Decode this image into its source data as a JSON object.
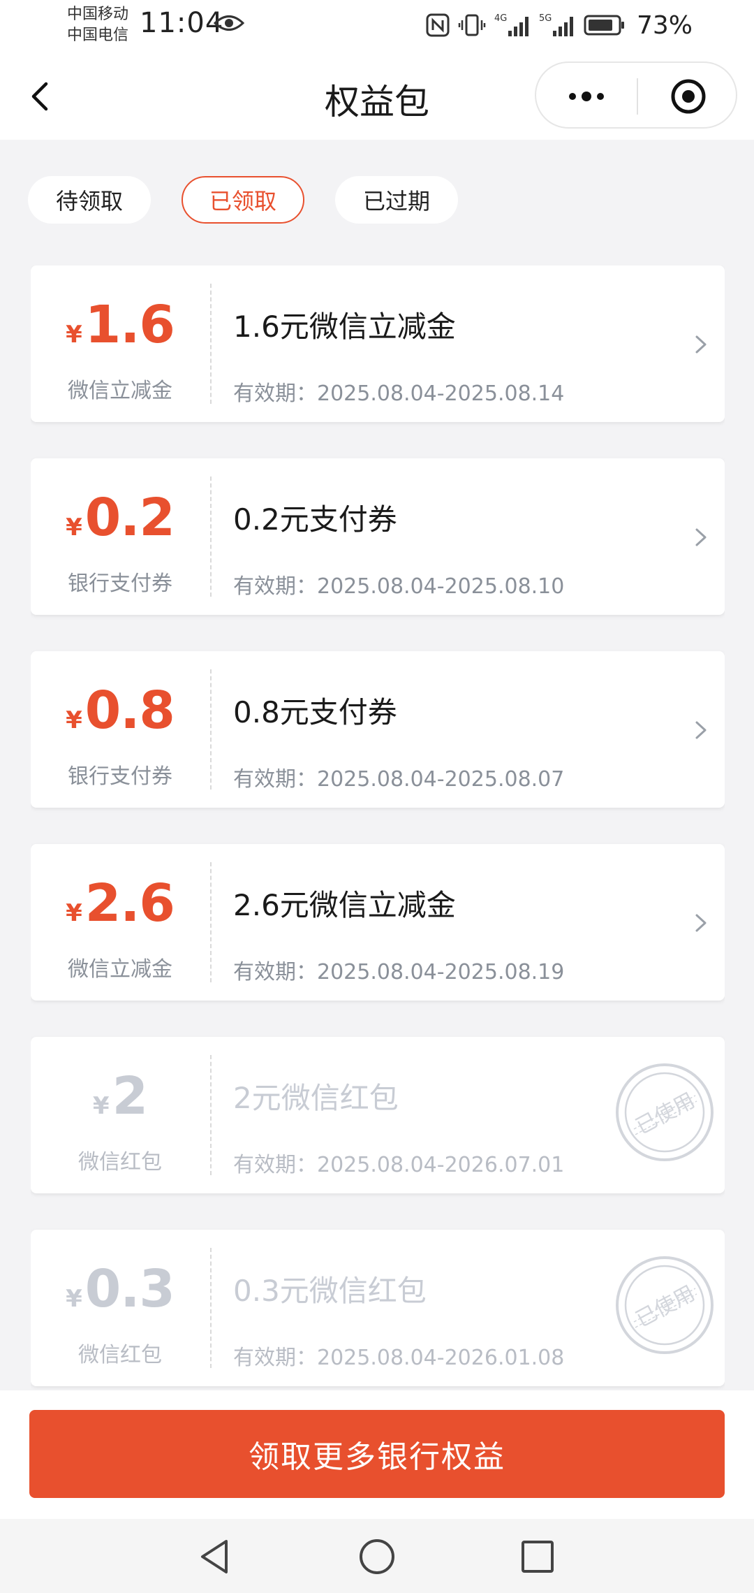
{
  "status_bar": {
    "carrier_1": "中国移动",
    "carrier_2": "中国电信",
    "time": "11:04",
    "network_1": "4G",
    "network_2": "5G",
    "battery": "73%"
  },
  "header": {
    "title": "权益包",
    "icons": [
      "chevron-left-icon",
      "more-dots-icon",
      "record-target-icon"
    ]
  },
  "tabs": [
    {
      "label": "待领取",
      "active": false
    },
    {
      "label": "已领取",
      "active": true
    },
    {
      "label": "已过期",
      "active": false
    }
  ],
  "coupons": [
    {
      "currency": "¥",
      "amount": "1.6",
      "kind": "微信立减金",
      "title": "1.6元微信立减金",
      "validity_label": "有效期：",
      "validity": "2025.08.04-2025.08.14",
      "used": false
    },
    {
      "currency": "¥",
      "amount": "0.2",
      "kind": "银行支付券",
      "title": "0.2元支付券",
      "validity_label": "有效期：",
      "validity": "2025.08.04-2025.08.10",
      "used": false
    },
    {
      "currency": "¥",
      "amount": "0.8",
      "kind": "银行支付券",
      "title": "0.8元支付券",
      "validity_label": "有效期：",
      "validity": "2025.08.04-2025.08.07",
      "used": false
    },
    {
      "currency": "¥",
      "amount": "2.6",
      "kind": "微信立减金",
      "title": "2.6元微信立减金",
      "validity_label": "有效期：",
      "validity": "2025.08.04-2025.08.19",
      "used": false
    },
    {
      "currency": "¥",
      "amount": "2",
      "kind": "微信红包",
      "title": "2元微信红包",
      "validity_label": "有效期：",
      "validity": "2025.08.04-2026.07.01",
      "used": true,
      "stamp": "已使用"
    },
    {
      "currency": "¥",
      "amount": "0.3",
      "kind": "微信红包",
      "title": "0.3元微信红包",
      "validity_label": "有效期：",
      "validity": "2025.08.04-2026.01.08",
      "used": true,
      "stamp": "已使用"
    }
  ],
  "bottom": {
    "button_label": "领取更多银行权益"
  },
  "colors": {
    "accent": "#e8502e",
    "muted": "#8a9099",
    "used": "#c8ccd4"
  }
}
